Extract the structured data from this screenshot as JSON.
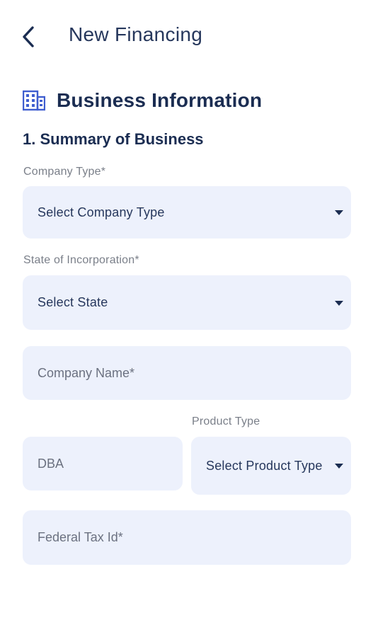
{
  "header": {
    "title": "New Financing"
  },
  "icons": {
    "back": "chevron-left-icon",
    "section": "building-icon",
    "dropdown": "caret-down-icon"
  },
  "colors": {
    "primary_text": "#1b2d52",
    "field_background": "#edf1fc",
    "label_text": "#7a7f89"
  },
  "section": {
    "title": "Business Information",
    "subsection_title": "1. Summary of Business"
  },
  "form": {
    "company_type": {
      "label": "Company Type*",
      "value": "Select Company Type"
    },
    "state_of_incorporation": {
      "label": "State of Incorporation*",
      "value": "Select State"
    },
    "company_name": {
      "placeholder": "Company Name*"
    },
    "dba": {
      "placeholder": "DBA"
    },
    "product_type": {
      "label": "Product Type",
      "value": "Select Product Type"
    },
    "federal_tax_id": {
      "placeholder": "Federal Tax Id*"
    }
  }
}
